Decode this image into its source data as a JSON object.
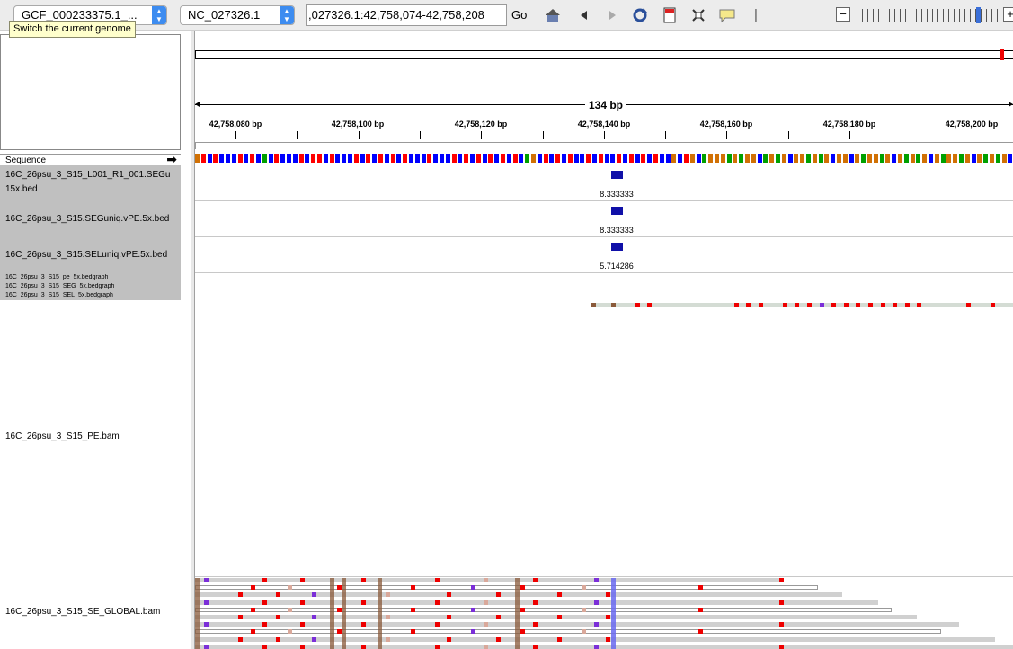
{
  "toolbar": {
    "genome": "GCF_000233375.1_...",
    "chromosome": "NC_027326.1",
    "locus": ",027326.1:42,758,074-42,758,208",
    "go_label": "Go",
    "tooltip": "Switch the current genome"
  },
  "icons": [
    "home-icon",
    "back-icon",
    "forward-icon",
    "refresh-icon",
    "ruler-icon",
    "fit-icon",
    "popup-icon"
  ],
  "ruler": {
    "span_label": "134 bp",
    "ticks": [
      "42,758,080 bp",
      "42,758,100 bp",
      "42,758,120 bp",
      "42,758,140 bp",
      "42,758,160 bp",
      "42,758,180 bp",
      "42,758,200 bp"
    ]
  },
  "tracks": {
    "sequence_label": "Sequence",
    "sequence_arrow": "➡",
    "bed1_name_a": "16C_26psu_3_S15_L001_R1_001.SEGu",
    "bed1_name_b": "15x.bed",
    "bed1_value": "8.333333",
    "bed2_name": "16C_26psu_3_S15.SEGuniq.vPE.5x.bed",
    "bed2_value": "8.333333",
    "bed3_name": "16C_26psu_3_S15.SELuniq.vPE.5x.bed",
    "bed3_value": "5.714286",
    "bedgraph_names": [
      "16C_26psu_3_S15_pe_5x.bedgraph",
      "16C_26psu_3_S15_SEG_5x.bedgraph",
      "16C_26psu_3_S15_SEL_5x.bedgraph"
    ],
    "bam_pe_name": "16C_26psu_3_S15_PE.bam",
    "bam_se_name": "16C_26psu_3_S15_SE_GLOBAL.bam"
  },
  "colors": {
    "A": "#00a000",
    "C": "#0000ff",
    "G": "#d17105",
    "T": "#ff0000",
    "feature": "#1010a8",
    "insertion": "#8a5a3a",
    "highlight": "#6a6af0"
  }
}
